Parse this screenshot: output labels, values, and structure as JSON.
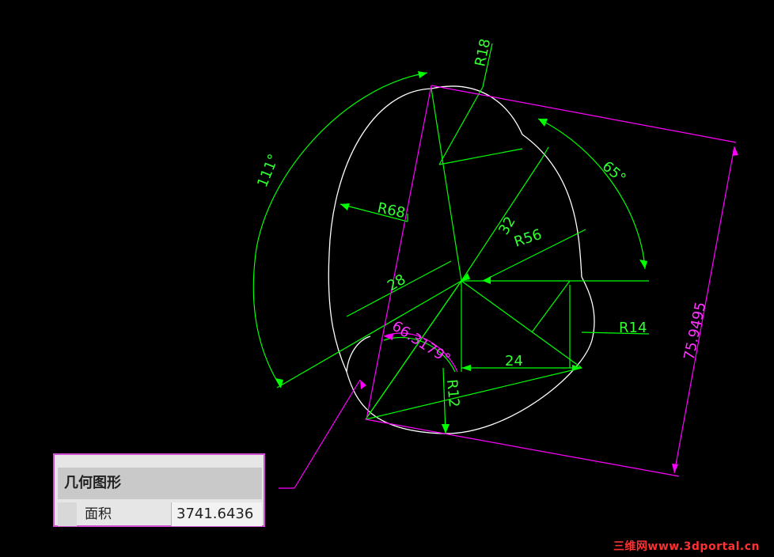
{
  "dimensions": {
    "r18": "R18",
    "r68": "R68",
    "d32": "32",
    "r56": "R56",
    "d28": "28",
    "r14": "R14",
    "d24": "24",
    "r12": "R12",
    "a111": "111°",
    "a65": "65°",
    "a66": "66.3179°",
    "d75": "75.9495"
  },
  "properties_panel": {
    "title": "几何图形",
    "area_label": "面积",
    "area_value": "3741.6436"
  },
  "watermark": "三维网www.3dportal.cn",
  "colors": {
    "background": "#000000",
    "outline": "#ffffff",
    "construction": "#00ff00",
    "measure": "#ff00ff",
    "dim_text": "#33ff33",
    "measure_text": "#ff33ff"
  }
}
